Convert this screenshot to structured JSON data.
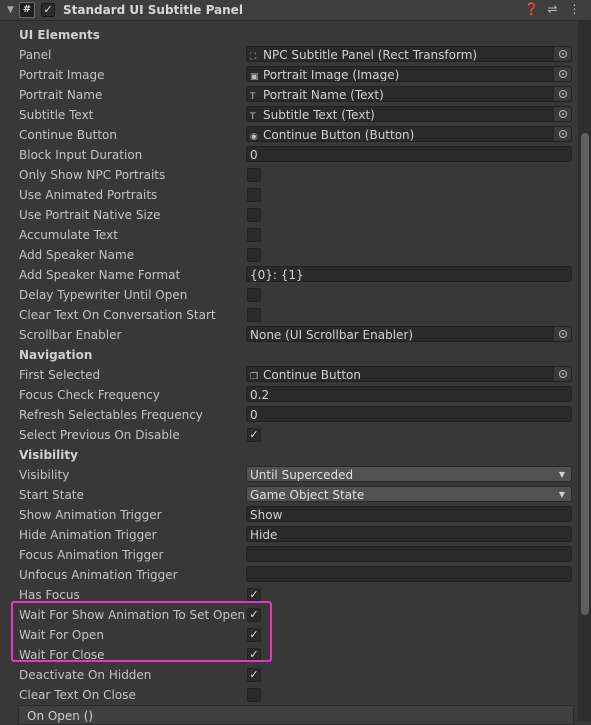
{
  "component": {
    "title": "Standard UI Subtitle Panel",
    "icons": [
      "help-icon",
      "preset-icon",
      "context-menu-icon"
    ],
    "enabled": true
  },
  "rows": [
    {
      "kind": "section",
      "label": "UI Elements"
    },
    {
      "kind": "object",
      "label": "Panel",
      "value": "NPC Subtitle Panel (Rect Transform)",
      "icon": "rect-transform-icon"
    },
    {
      "kind": "object",
      "label": "Portrait Image",
      "value": "Portrait Image (Image)",
      "icon": "image-icon"
    },
    {
      "kind": "object",
      "label": "Portrait Name",
      "value": "Portrait Name (Text)",
      "icon": "text-icon"
    },
    {
      "kind": "object",
      "label": "Subtitle Text",
      "value": "Subtitle Text (Text)",
      "icon": "text-icon"
    },
    {
      "kind": "object",
      "label": "Continue Button",
      "value": "Continue Button (Button)",
      "icon": "button-icon"
    },
    {
      "kind": "text",
      "label": "Block Input Duration",
      "value": "0"
    },
    {
      "kind": "check",
      "label": "Only Show NPC Portraits",
      "checked": false
    },
    {
      "kind": "check",
      "label": "Use Animated Portraits",
      "checked": false
    },
    {
      "kind": "check",
      "label": "Use Portrait Native Size",
      "checked": false
    },
    {
      "kind": "check",
      "label": "Accumulate Text",
      "checked": false
    },
    {
      "kind": "check",
      "label": "Add Speaker Name",
      "checked": false
    },
    {
      "kind": "text",
      "label": "Add Speaker Name Format",
      "value": "{0}: {1}"
    },
    {
      "kind": "check",
      "label": "Delay Typewriter Until Open",
      "checked": false
    },
    {
      "kind": "check",
      "label": "Clear Text On Conversation Start",
      "checked": false
    },
    {
      "kind": "object",
      "label": "Scrollbar Enabler",
      "value": "None (UI Scrollbar Enabler)",
      "icon": ""
    },
    {
      "kind": "section",
      "label": "Navigation"
    },
    {
      "kind": "object",
      "label": "First Selected",
      "value": "Continue Button",
      "icon": "gameobject-icon"
    },
    {
      "kind": "text",
      "label": "Focus Check Frequency",
      "value": "0.2"
    },
    {
      "kind": "text",
      "label": "Refresh Selectables Frequency",
      "value": "0"
    },
    {
      "kind": "check",
      "label": "Select Previous On Disable",
      "checked": true
    },
    {
      "kind": "section",
      "label": "Visibility"
    },
    {
      "kind": "dropdown",
      "label": "Visibility",
      "value": "Until Superceded"
    },
    {
      "kind": "dropdown",
      "label": "Start State",
      "value": "Game Object State"
    },
    {
      "kind": "text",
      "label": "Show Animation Trigger",
      "value": "Show"
    },
    {
      "kind": "text",
      "label": "Hide Animation Trigger",
      "value": "Hide"
    },
    {
      "kind": "text",
      "label": "Focus Animation Trigger",
      "value": ""
    },
    {
      "kind": "text",
      "label": "Unfocus Animation Trigger",
      "value": ""
    },
    {
      "kind": "check",
      "label": "Has Focus",
      "checked": true
    },
    {
      "kind": "check",
      "label": "Wait For Show Animation To Set Open",
      "checked": true
    },
    {
      "kind": "check",
      "label": "Wait For Open",
      "checked": true
    },
    {
      "kind": "check",
      "label": "Wait For Close",
      "checked": true
    },
    {
      "kind": "check",
      "label": "Deactivate On Hidden",
      "checked": true
    },
    {
      "kind": "check",
      "label": "Clear Text On Close",
      "checked": false
    }
  ],
  "event": {
    "label": "On Open ()"
  },
  "highlight_color": "#e635c8"
}
